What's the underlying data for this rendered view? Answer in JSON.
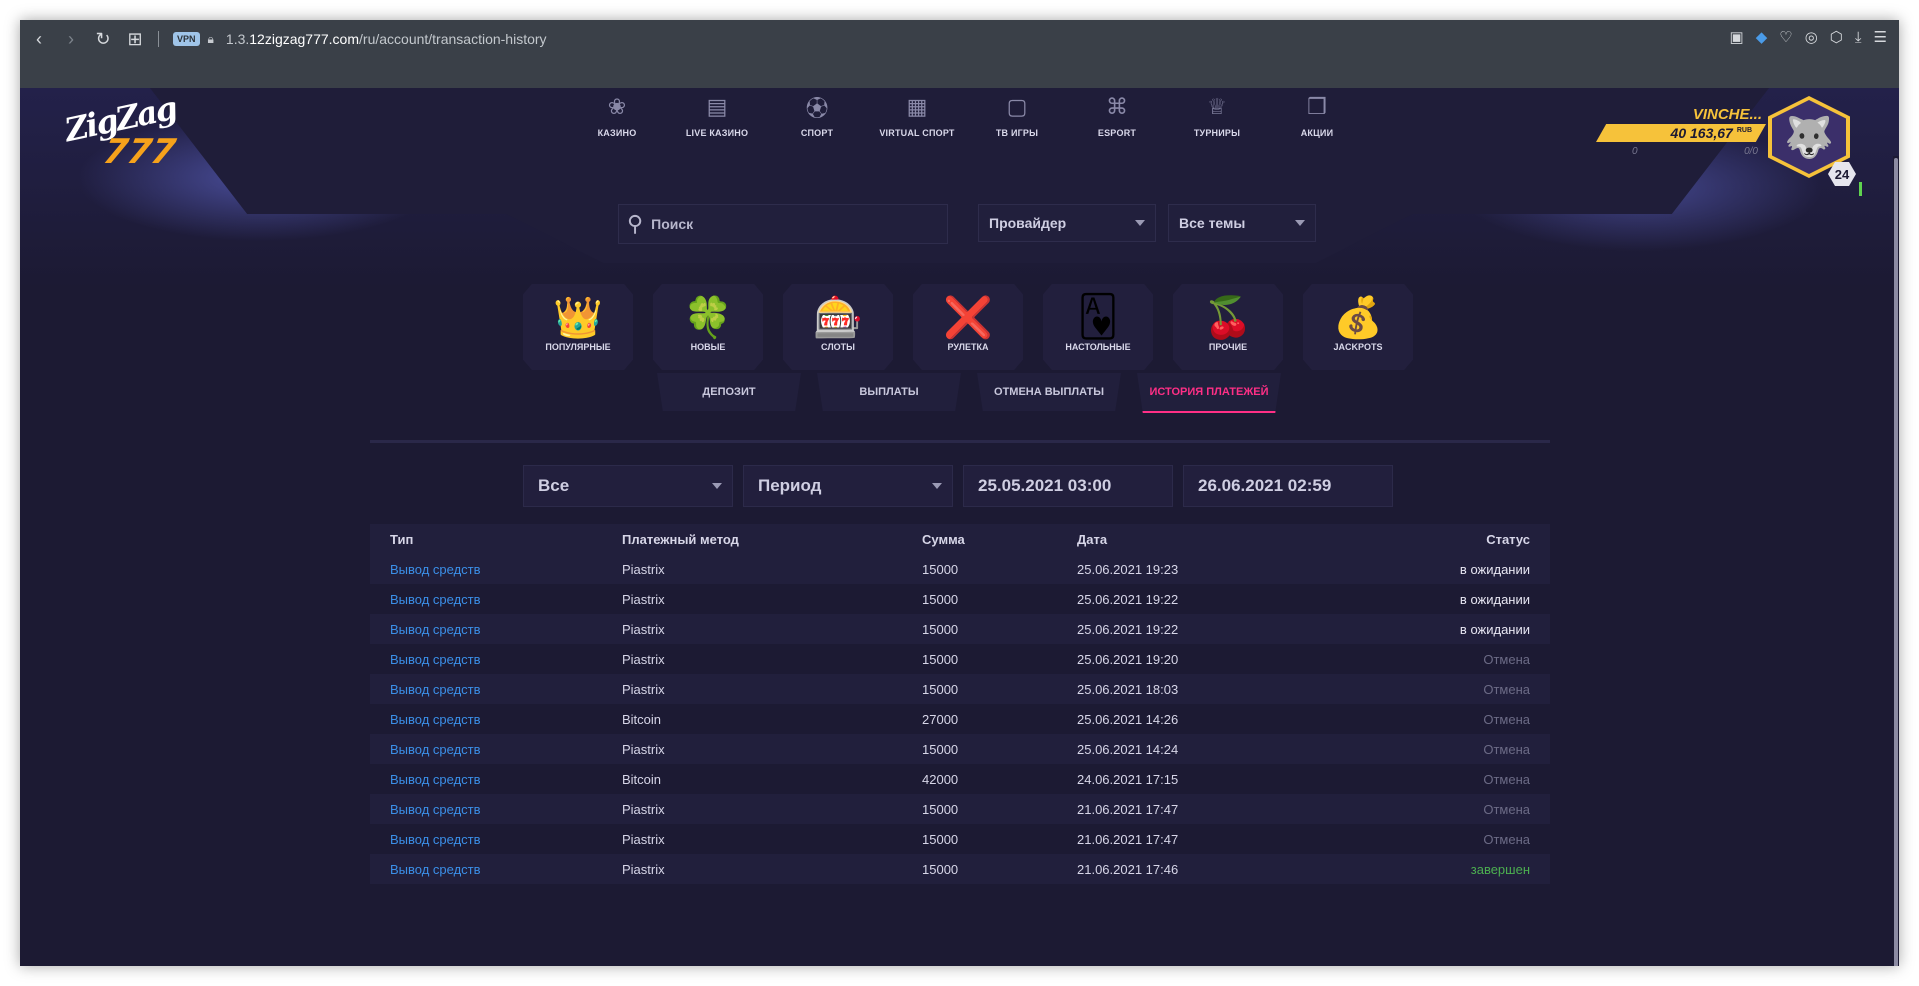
{
  "browser": {
    "vpn_label": "VPN",
    "url_prefix": "1.3.",
    "url_host": "12zigzag777.com",
    "url_path": "/ru/account/transaction-history"
  },
  "site": {
    "logo_top": "ZigZag",
    "logo_bottom": "777",
    "nav": [
      {
        "label": "КАЗИНО",
        "icon": "roulette-wheel-icon"
      },
      {
        "label": "LIVE КАЗИНО",
        "icon": "live-tv-icon"
      },
      {
        "label": "СПОРТ",
        "icon": "soccer-ball-icon"
      },
      {
        "label": "VIRTUAL СПОРТ",
        "icon": "virtual-sport-icon"
      },
      {
        "label": "ТВ ИГРЫ",
        "icon": "tv-icon"
      },
      {
        "label": "ESPORT",
        "icon": "gamepad-icon"
      },
      {
        "label": "ТУРНИРЫ",
        "icon": "trophy-icon"
      },
      {
        "label": "АКЦИИ",
        "icon": "gift-icon"
      }
    ],
    "search_placeholder": "Поиск",
    "provider_label": "Провайдер",
    "themes_label": "Все темы",
    "categories": [
      {
        "label": "ПОПУЛЯРНЫЕ",
        "icon": "crown-icon"
      },
      {
        "label": "НОВЫЕ",
        "icon": "clover-icon"
      },
      {
        "label": "СЛОТЫ",
        "icon": "slot-machine-icon"
      },
      {
        "label": "РУЛЕТКА",
        "icon": "roulette-icon"
      },
      {
        "label": "НАСТОЛЬНЫЕ",
        "icon": "card-icon"
      },
      {
        "label": "ПРОЧИЕ",
        "icon": "cherry-icon"
      },
      {
        "label": "JACKPOTS",
        "icon": "money-bag-icon"
      }
    ]
  },
  "profile": {
    "name": "VINCHE...",
    "balance": "40 163,67",
    "currency": "RUB",
    "left_count": "0",
    "ratio": "0/0",
    "level": "24"
  },
  "tabs": [
    {
      "label": "ДЕПОЗИТ",
      "active": false
    },
    {
      "label": "ВЫПЛАТЫ",
      "active": false
    },
    {
      "label": "ОТМЕНА ВЫПЛАТЫ",
      "active": false
    },
    {
      "label": "ИСТОРИЯ ПЛАТЕЖЕЙ",
      "active": true
    }
  ],
  "filters": {
    "type": "Все",
    "period": "Период",
    "date_from": "25.05.2021 03:00",
    "date_to": "26.06.2021 02:59"
  },
  "table": {
    "headers": [
      "Тип",
      "Платежный метод",
      "Сумма",
      "Дата",
      "Статус"
    ],
    "rows": [
      {
        "type": "Вывод средств",
        "method": "Piastrix",
        "amount": "15000",
        "date": "25.06.2021 19:23",
        "status": "в ожидании",
        "kind": "wait"
      },
      {
        "type": "Вывод средств",
        "method": "Piastrix",
        "amount": "15000",
        "date": "25.06.2021 19:22",
        "status": "в ожидании",
        "kind": "wait"
      },
      {
        "type": "Вывод средств",
        "method": "Piastrix",
        "amount": "15000",
        "date": "25.06.2021 19:22",
        "status": "в ожидании",
        "kind": "wait"
      },
      {
        "type": "Вывод средств",
        "method": "Piastrix",
        "amount": "15000",
        "date": "25.06.2021 19:20",
        "status": "Отмена",
        "kind": "cancel"
      },
      {
        "type": "Вывод средств",
        "method": "Piastrix",
        "amount": "15000",
        "date": "25.06.2021 18:03",
        "status": "Отмена",
        "kind": "cancel"
      },
      {
        "type": "Вывод средств",
        "method": "Bitcoin",
        "amount": "27000",
        "date": "25.06.2021 14:26",
        "status": "Отмена",
        "kind": "cancel"
      },
      {
        "type": "Вывод средств",
        "method": "Piastrix",
        "amount": "15000",
        "date": "25.06.2021 14:24",
        "status": "Отмена",
        "kind": "cancel"
      },
      {
        "type": "Вывод средств",
        "method": "Bitcoin",
        "amount": "42000",
        "date": "24.06.2021 17:15",
        "status": "Отмена",
        "kind": "cancel"
      },
      {
        "type": "Вывод средств",
        "method": "Piastrix",
        "amount": "15000",
        "date": "21.06.2021 17:47",
        "status": "Отмена",
        "kind": "cancel"
      },
      {
        "type": "Вывод средств",
        "method": "Piastrix",
        "amount": "15000",
        "date": "21.06.2021 17:47",
        "status": "Отмена",
        "kind": "cancel"
      },
      {
        "type": "Вывод средств",
        "method": "Piastrix",
        "amount": "15000",
        "date": "21.06.2021 17:46",
        "status": "завершен",
        "kind": "done"
      }
    ]
  },
  "colors": {
    "accent": "#ff2f86",
    "gold": "#f6c23a",
    "link": "#3b8fe8",
    "done": "#4caf50",
    "background": "#1c1a33"
  }
}
